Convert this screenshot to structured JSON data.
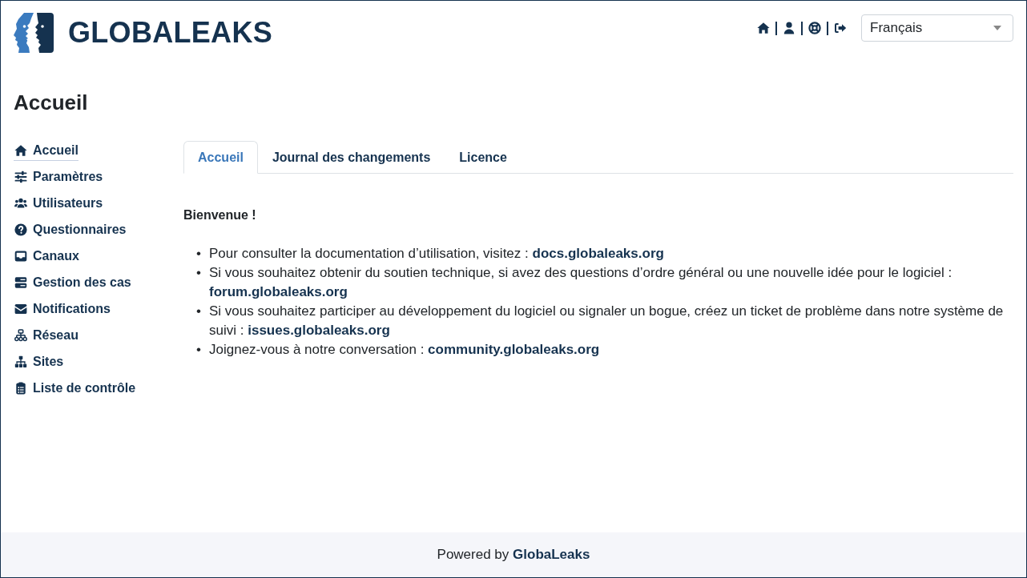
{
  "header": {
    "logo_text": "GLOBALEAKS",
    "language_select": {
      "value": "Français"
    }
  },
  "page_title": "Accueil",
  "sidebar": {
    "items": [
      {
        "label": "Accueil",
        "selected": true
      },
      {
        "label": "Paramètres",
        "selected": false
      },
      {
        "label": "Utilisateurs",
        "selected": false
      },
      {
        "label": "Questionnaires",
        "selected": false
      },
      {
        "label": "Canaux",
        "selected": false
      },
      {
        "label": "Gestion des cas",
        "selected": false
      },
      {
        "label": "Notifications",
        "selected": false
      },
      {
        "label": "Réseau",
        "selected": false
      },
      {
        "label": "Sites",
        "selected": false
      },
      {
        "label": "Liste de contrôle",
        "selected": false
      }
    ]
  },
  "tabs": [
    {
      "label": "Accueil",
      "selected": true
    },
    {
      "label": "Journal des changements",
      "selected": false
    },
    {
      "label": "Licence",
      "selected": false
    }
  ],
  "content": {
    "heading": "Bienvenue !",
    "items": [
      {
        "marker": "•",
        "text": "Pour consulter la documentation d’utilisation, visitez :",
        "link": "docs.globaleaks.org"
      },
      {
        "marker": "•",
        "text": "Si vous souhaitez obtenir du soutien technique, si avez des questions d’ordre général ou une nouvelle idée pour le logiciel :",
        "link": "forum.globaleaks.org"
      },
      {
        "marker": "•",
        "text": "Si vous souhaitez participer au développement du logiciel ou signaler un bogue, créez un ticket de problème dans notre système de suivi :",
        "link": "issues.globaleaks.org"
      },
      {
        "marker": "•",
        "text": "Joignez-vous à notre conversation :",
        "link": "community.globaleaks.org"
      }
    ]
  },
  "footer": {
    "text": "Powered by",
    "link": "GlobaLeaks"
  }
}
